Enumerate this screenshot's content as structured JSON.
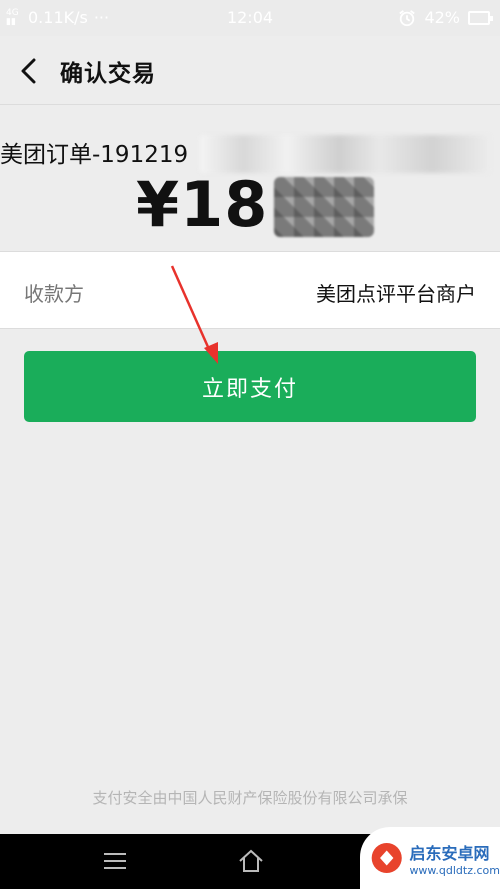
{
  "status_bar": {
    "network_speed": "0.11K/s",
    "dots": "···",
    "time": "12:04",
    "battery": "42%"
  },
  "header": {
    "back_icon": "chevron-left-icon",
    "title": "确认交易"
  },
  "order": {
    "title": "美团订单-191219",
    "amount": "¥18"
  },
  "payee": {
    "label": "收款方",
    "value": "美团点评平台商户"
  },
  "pay_button": {
    "label": "立即支付",
    "color": "#1aad5a"
  },
  "footer": {
    "note": "支付安全由中国人民财产保险股份有限公司承保"
  },
  "nav_bar": {
    "icons": [
      "menu-icon",
      "home-icon",
      "back-icon"
    ]
  },
  "watermark": {
    "name": "启东安卓网",
    "url": "www.qdldtz.com"
  },
  "colors": {
    "accent": "#1aad5a",
    "annotation_arrow": "#e8322c"
  }
}
